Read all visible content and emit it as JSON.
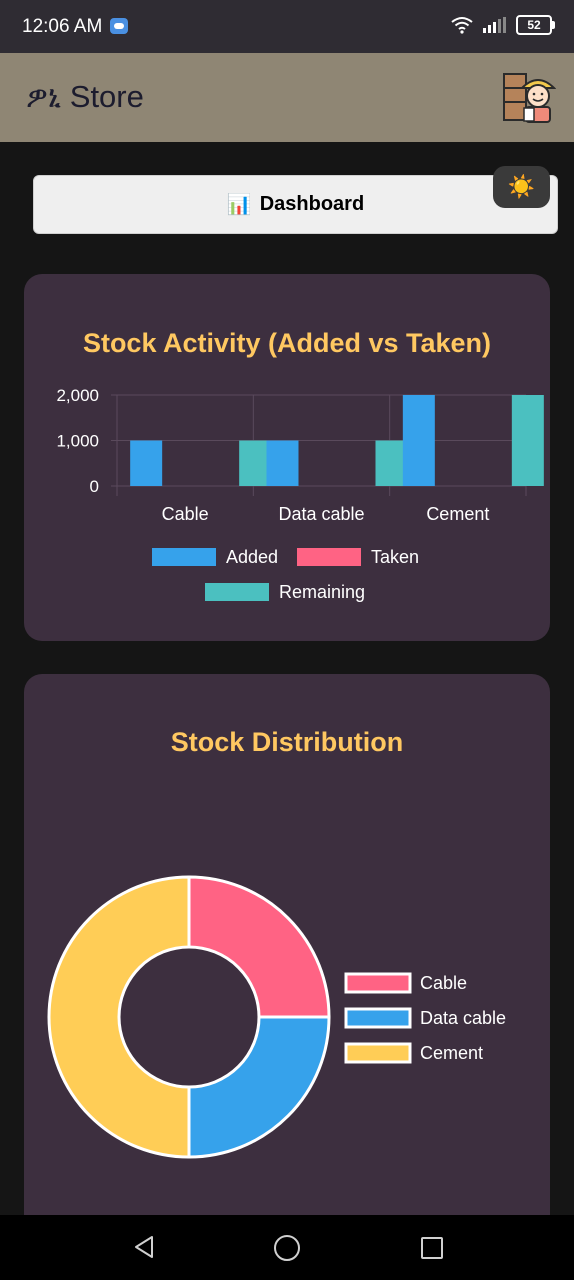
{
  "status_bar": {
    "time": "12:06 AM",
    "battery": "52"
  },
  "header": {
    "title": "ዎኒ Store"
  },
  "dashboard_button": {
    "icon": "📊",
    "label": "Dashboard"
  },
  "theme_toggle": {
    "icon": "☀️"
  },
  "chart_data": [
    {
      "type": "bar",
      "title": "Stock Activity (Added vs Taken)",
      "categories": [
        "Cable",
        "Data cable",
        "Cement"
      ],
      "series": [
        {
          "name": "Added",
          "values": [
            1000,
            1000,
            2000
          ],
          "color": "#36a2eb"
        },
        {
          "name": "Taken",
          "values": [
            0,
            0,
            0
          ],
          "color": "#ff6384"
        },
        {
          "name": "Remaining",
          "values": [
            1000,
            1000,
            2000
          ],
          "color": "#4bc0c0"
        }
      ],
      "ylim": [
        0,
        2000
      ],
      "yticks": [
        "2,000",
        "1,000",
        "0"
      ],
      "ytick_values": [
        2000,
        1000,
        0
      ],
      "legend": "bottom",
      "grid": true
    },
    {
      "type": "pie",
      "title": "Stock Distribution",
      "categories": [
        "Cable",
        "Data cable",
        "Cement"
      ],
      "values": [
        1000,
        1000,
        2000
      ],
      "colors": [
        "#ff6384",
        "#36a2eb",
        "#ffcd56"
      ],
      "legend": "right"
    }
  ]
}
